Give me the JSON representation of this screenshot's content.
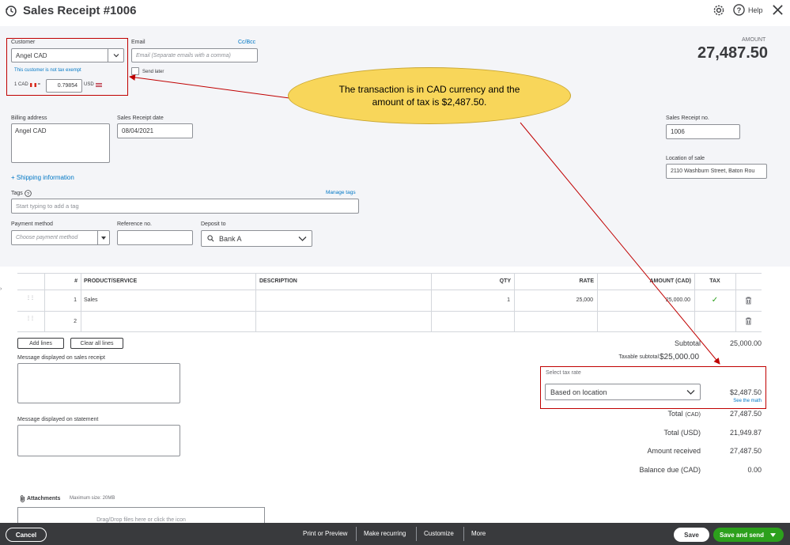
{
  "title": "Sales Receipt #1006",
  "header": {
    "help_label": "Help"
  },
  "customer": {
    "label": "Customer",
    "value": "Angel CAD",
    "tax_note": "This customer is not tax exempt",
    "fx_prefix": "1 CAD",
    "fx_eq": "=",
    "fx_rate": "0.79854",
    "fx_suffix": "USD"
  },
  "email": {
    "label": "Email",
    "ccbcc": "Cc/Bcc",
    "placeholder": "Email (Separate emails with a comma)",
    "send_later": "Send later"
  },
  "amount": {
    "label": "AMOUNT",
    "value": "27,487.50"
  },
  "callout_text": "The transaction is in CAD currency and the amount of tax is $2,487.50.",
  "billing": {
    "label": "Billing address",
    "value": "Angel CAD"
  },
  "receipt_date": {
    "label": "Sales Receipt date",
    "value": "08/04/2021"
  },
  "receipt_no": {
    "label": "Sales Receipt no.",
    "value": "1006"
  },
  "location": {
    "label": "Location of sale",
    "value": "2110 Washburn Street, Baton Rou"
  },
  "shipping_link": "+ Shipping information",
  "tags": {
    "label": "Tags",
    "manage": "Manage tags",
    "placeholder": "Start typing to add a tag"
  },
  "payment": {
    "label": "Payment method",
    "placeholder": "Choose payment method"
  },
  "reference": {
    "label": "Reference no."
  },
  "deposit": {
    "label": "Deposit to",
    "value": "Bank A"
  },
  "table": {
    "headers": [
      "#",
      "PRODUCT/SERVICE",
      "DESCRIPTION",
      "QTY",
      "RATE",
      "AMOUNT (CAD)",
      "TAX"
    ],
    "rows": [
      {
        "num": "1",
        "product": "Sales",
        "description": "",
        "qty": "1",
        "rate": "25,000",
        "amount": "25,000.00",
        "tax": "✓"
      },
      {
        "num": "2",
        "product": "",
        "description": "",
        "qty": "",
        "rate": "",
        "amount": "",
        "tax": ""
      }
    ]
  },
  "buttons": {
    "add_lines": "Add lines",
    "clear_lines": "Clear all lines"
  },
  "message_receipt_label": "Message displayed on sales receipt",
  "message_statement_label": "Message displayed on statement",
  "summary": {
    "subtotal_label": "Subtotal",
    "subtotal": "25,000.00",
    "taxable_label": "Taxable subtotal",
    "taxable": "$25,000.00",
    "select_tax_label": "Select tax rate",
    "tax_rate": "Based on location",
    "tax_amount": "$2,487.50",
    "see_math": "See the math",
    "total_cad_label": "Total",
    "total_cad_unit": "(CAD)",
    "total_cad": "27,487.50",
    "total_usd_label": "Total (USD)",
    "total_usd": "21,949.87",
    "received_label": "Amount received",
    "received": "27,487.50",
    "balance_label": "Balance due (CAD)",
    "balance": "0.00"
  },
  "attachments": {
    "label": "Attachments",
    "max": "Maximum size: 20MB",
    "drop": "Drag/Drop files here or click the icon"
  },
  "footer": {
    "cancel": "Cancel",
    "print": "Print or Preview",
    "recurring": "Make recurring",
    "customize": "Customize",
    "more": "More",
    "save": "Save",
    "save_send": "Save and send"
  },
  "colors": {
    "accent_green": "#2ca01c",
    "link_blue": "#0077c5",
    "callout_yellow": "#f8d65a",
    "annotation_red": "#c00000",
    "footer_dark": "#393a3d"
  }
}
